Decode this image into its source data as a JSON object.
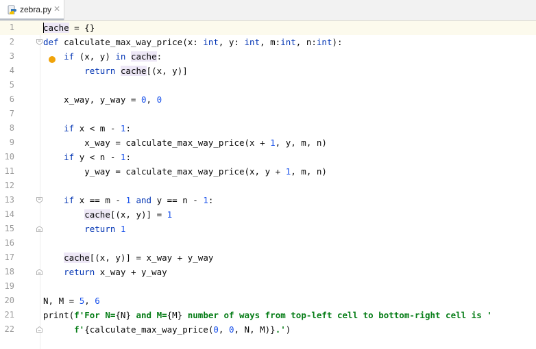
{
  "tab": {
    "filename": "zebra.py",
    "close_glyph": "✕",
    "icon": "python-file-icon"
  },
  "colors": {
    "keyword": "#0033b3",
    "number": "#1750eb",
    "string": "#067d17",
    "identifier_highlight": "#ede7f6",
    "current_line": "#fcfaed",
    "intention_bulb": "#f0a30a"
  },
  "editor": {
    "current_line": 1,
    "lines": [
      {
        "num": "1",
        "tokens": [
          {
            "t": "cache",
            "c": "cache"
          },
          {
            "t": " = {}"
          }
        ]
      },
      {
        "num": "2",
        "tokens": [
          {
            "t": "def",
            "c": "kw"
          },
          {
            "t": " calculate_max_way_price(x: "
          },
          {
            "t": "int",
            "c": "kw"
          },
          {
            "t": ", y: "
          },
          {
            "t": "int",
            "c": "kw"
          },
          {
            "t": ", m:"
          },
          {
            "t": "int",
            "c": "kw"
          },
          {
            "t": ", n:"
          },
          {
            "t": "int",
            "c": "kw"
          },
          {
            "t": "):"
          }
        ]
      },
      {
        "num": "3",
        "tokens": [
          {
            "t": "    "
          },
          {
            "t": "if",
            "c": "kw"
          },
          {
            "t": " (x, y) "
          },
          {
            "t": "in",
            "c": "kw"
          },
          {
            "t": " "
          },
          {
            "t": "cache",
            "c": "cache"
          },
          {
            "t": ":"
          }
        ]
      },
      {
        "num": "4",
        "tokens": [
          {
            "t": "        "
          },
          {
            "t": "return",
            "c": "kw"
          },
          {
            "t": " "
          },
          {
            "t": "cache",
            "c": "cache"
          },
          {
            "t": "[(x, y)]"
          }
        ]
      },
      {
        "num": "5",
        "tokens": []
      },
      {
        "num": "6",
        "tokens": [
          {
            "t": "    x_way, y_way = "
          },
          {
            "t": "0",
            "c": "num"
          },
          {
            "t": ", "
          },
          {
            "t": "0",
            "c": "num"
          }
        ]
      },
      {
        "num": "7",
        "tokens": []
      },
      {
        "num": "8",
        "tokens": [
          {
            "t": "    "
          },
          {
            "t": "if",
            "c": "kw"
          },
          {
            "t": " x < m - "
          },
          {
            "t": "1",
            "c": "num"
          },
          {
            "t": ":"
          }
        ]
      },
      {
        "num": "9",
        "tokens": [
          {
            "t": "        x_way = calculate_max_way_price(x + "
          },
          {
            "t": "1",
            "c": "num"
          },
          {
            "t": ", y, m, n)"
          }
        ]
      },
      {
        "num": "10",
        "tokens": [
          {
            "t": "    "
          },
          {
            "t": "if",
            "c": "kw"
          },
          {
            "t": " y < n - "
          },
          {
            "t": "1",
            "c": "num"
          },
          {
            "t": ":"
          }
        ]
      },
      {
        "num": "11",
        "tokens": [
          {
            "t": "        y_way = calculate_max_way_price(x, y + "
          },
          {
            "t": "1",
            "c": "num"
          },
          {
            "t": ", m, n)"
          }
        ]
      },
      {
        "num": "12",
        "tokens": []
      },
      {
        "num": "13",
        "tokens": [
          {
            "t": "    "
          },
          {
            "t": "if",
            "c": "kw"
          },
          {
            "t": " x == m - "
          },
          {
            "t": "1",
            "c": "num"
          },
          {
            "t": " "
          },
          {
            "t": "and",
            "c": "kw"
          },
          {
            "t": " y == n - "
          },
          {
            "t": "1",
            "c": "num"
          },
          {
            "t": ":"
          }
        ]
      },
      {
        "num": "14",
        "tokens": [
          {
            "t": "        "
          },
          {
            "t": "cache",
            "c": "cache"
          },
          {
            "t": "[(x, y)] = "
          },
          {
            "t": "1",
            "c": "num"
          }
        ]
      },
      {
        "num": "15",
        "tokens": [
          {
            "t": "        "
          },
          {
            "t": "return",
            "c": "kw"
          },
          {
            "t": " "
          },
          {
            "t": "1",
            "c": "num"
          }
        ]
      },
      {
        "num": "16",
        "tokens": []
      },
      {
        "num": "17",
        "tokens": [
          {
            "t": "    "
          },
          {
            "t": "cache",
            "c": "cache"
          },
          {
            "t": "[(x, y)] = x_way + y_way"
          }
        ]
      },
      {
        "num": "18",
        "tokens": [
          {
            "t": "    "
          },
          {
            "t": "return",
            "c": "kw"
          },
          {
            "t": " x_way + y_way"
          }
        ]
      },
      {
        "num": "19",
        "tokens": []
      },
      {
        "num": "20",
        "tokens": [
          {
            "t": "N, M = "
          },
          {
            "t": "5",
            "c": "num"
          },
          {
            "t": ", "
          },
          {
            "t": "6",
            "c": "num"
          }
        ]
      },
      {
        "num": "21",
        "tokens": [
          {
            "t": "print"
          },
          {
            "t": "("
          },
          {
            "t": "f'For N=",
            "c": "str"
          },
          {
            "t": "{N}"
          },
          {
            "t": " and M=",
            "c": "str"
          },
          {
            "t": "{M}"
          },
          {
            "t": " number of ways from top-left cell to bottom-right cell is '",
            "c": "str"
          }
        ]
      },
      {
        "num": "22",
        "tokens": [
          {
            "t": "      "
          },
          {
            "t": "f'",
            "c": "str"
          },
          {
            "t": "{calculate_max_way_price("
          },
          {
            "t": "0",
            "c": "num"
          },
          {
            "t": ", "
          },
          {
            "t": "0",
            "c": "num"
          },
          {
            "t": ", N, M)}"
          },
          {
            "t": ".'",
            "c": "str"
          },
          {
            "t": ")"
          }
        ]
      }
    ],
    "fold_markers": [
      {
        "line": 2,
        "kind": "open"
      },
      {
        "line": 13,
        "kind": "open"
      },
      {
        "line": 15,
        "kind": "close"
      },
      {
        "line": 18,
        "kind": "close"
      },
      {
        "line": 22,
        "kind": "close"
      }
    ]
  }
}
